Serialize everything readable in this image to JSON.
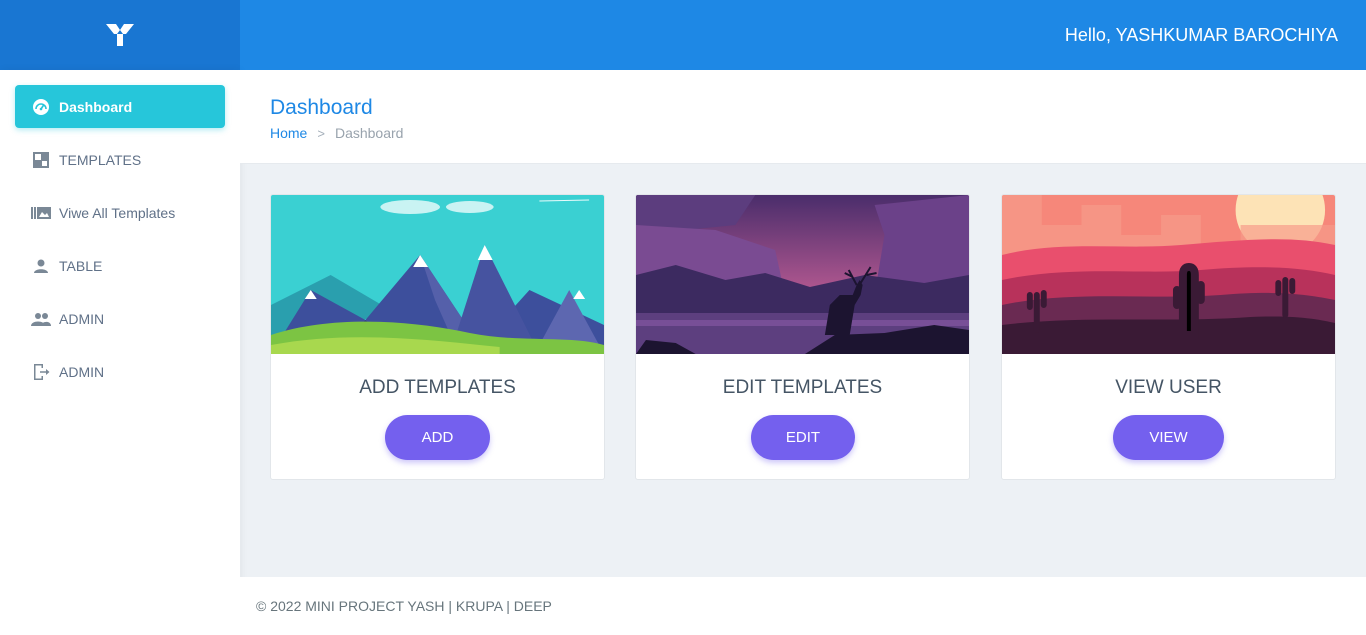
{
  "header": {
    "greeting": "Hello, YASHKUMAR BAROCHIYA",
    "logo_icon": "brand-logo-icon",
    "brand_color": "#1e88e5"
  },
  "sidebar": {
    "items": [
      {
        "label": "Dashboard",
        "icon": "speedometer-icon",
        "active": true
      },
      {
        "label": "TEMPLATES",
        "icon": "grid-icon",
        "active": false
      },
      {
        "label": "Viwe All Templates",
        "icon": "gallery-icon",
        "active": false
      },
      {
        "label": "TABLE",
        "icon": "user-icon",
        "active": false
      },
      {
        "label": "ADMIN",
        "icon": "users-icon",
        "active": false
      },
      {
        "label": "ADMIN",
        "icon": "logout-icon",
        "active": false
      }
    ],
    "active_color": "#26c6da"
  },
  "page": {
    "title": "Dashboard",
    "breadcrumb": {
      "home": "Home",
      "separator": ">",
      "current": "Dashboard"
    }
  },
  "cards": [
    {
      "title": "ADD TEMPLATES",
      "button": "ADD",
      "image": "mountains-illustration"
    },
    {
      "title": "EDIT TEMPLATES",
      "button": "EDIT",
      "image": "deer-landscape-illustration"
    },
    {
      "title": "VIEW USER",
      "button": "VIEW",
      "image": "desert-cactus-illustration"
    }
  ],
  "button_color": "#7460ee",
  "footer": {
    "text": "© 2022 MINI PROJECT YASH | KRUPA | DEEP"
  }
}
